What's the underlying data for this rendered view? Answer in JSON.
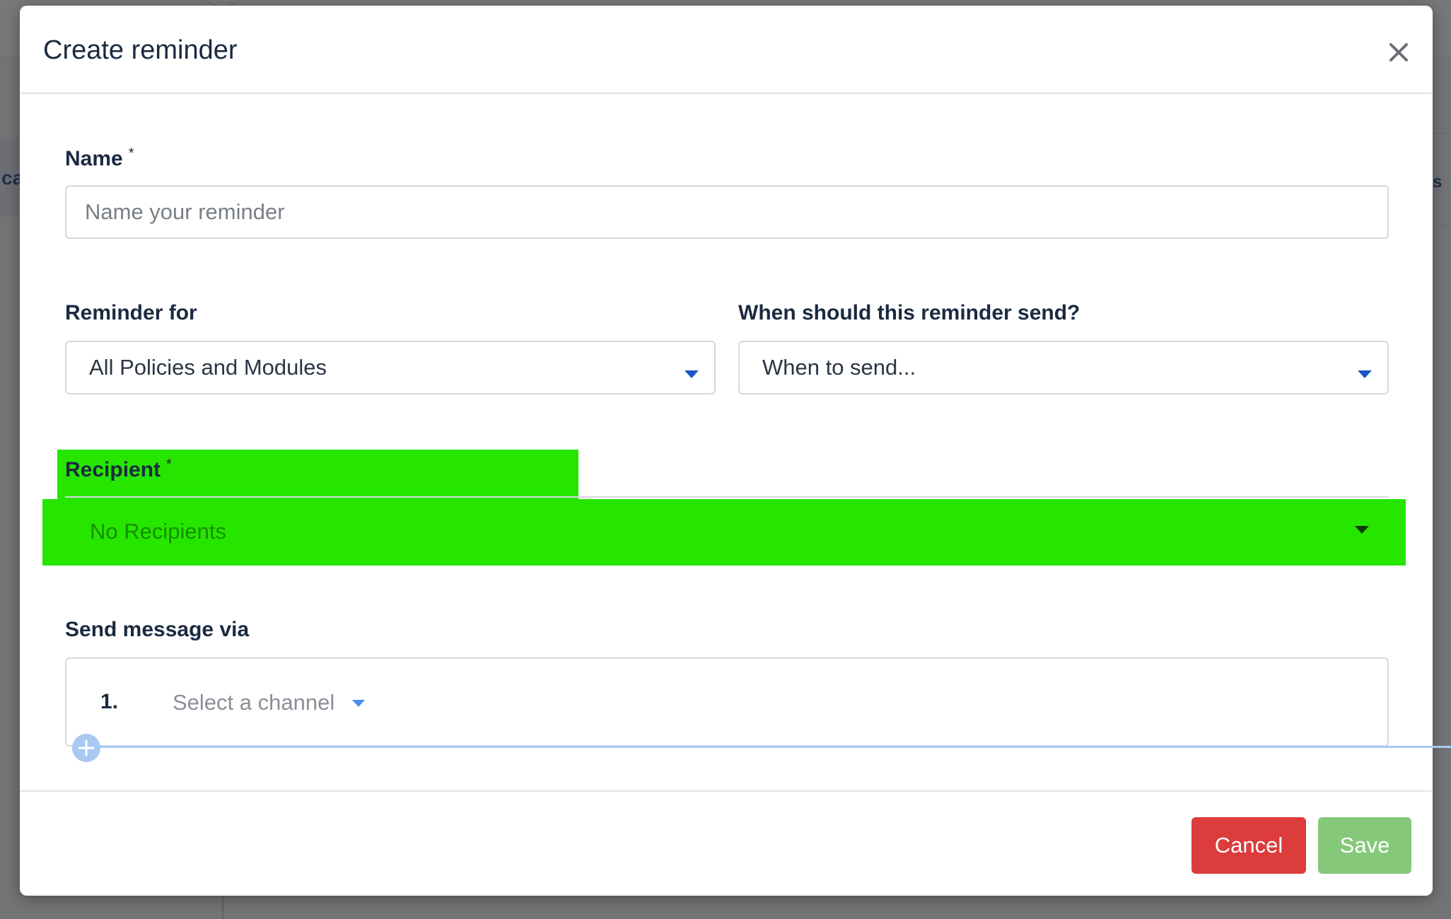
{
  "modal": {
    "title": "Create reminder"
  },
  "form": {
    "name": {
      "label": "Name",
      "required_mark": "*",
      "placeholder": "Name your reminder",
      "value": ""
    },
    "reminder_for": {
      "label": "Reminder for",
      "selected": "All Policies and Modules"
    },
    "when_to_send": {
      "label": "When should this reminder send?",
      "selected": "When to send..."
    },
    "recipient": {
      "label": "Recipient",
      "required_mark": "*",
      "selected": "No Recipients",
      "highlight_color": "#26e600"
    },
    "send_via": {
      "label": "Send message via",
      "channels": [
        {
          "number": "1.",
          "placeholder": "Select a channel"
        }
      ]
    }
  },
  "footer": {
    "cancel_label": "Cancel",
    "save_label": "Save"
  },
  "colors": {
    "accent": "#1a56c4",
    "cancel": "#dc3c3c",
    "save": "#86c879"
  },
  "background": {
    "sidebar_text": "ca",
    "right_edge_text": "s"
  }
}
